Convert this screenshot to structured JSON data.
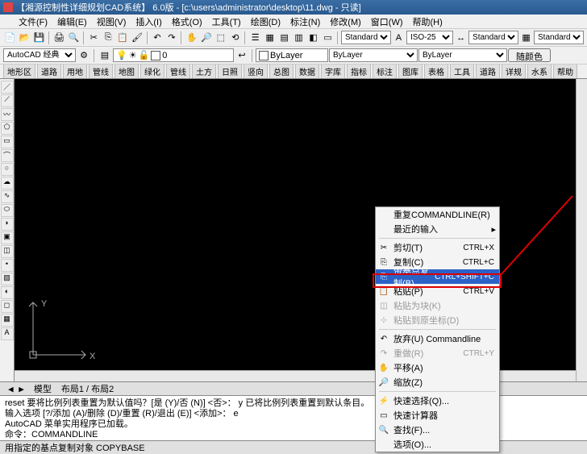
{
  "title": "【湘源控制性详细规划CAD系统】 6.0版 - [c:\\users\\administrator\\desktop\\11.dwg - 只读]",
  "menu": [
    "文件(F)",
    "编辑(E)",
    "视图(V)",
    "插入(I)",
    "格式(O)",
    "工具(T)",
    "绘图(D)",
    "标注(N)",
    "修改(M)",
    "窗口(W)",
    "帮助(H)"
  ],
  "workspace": "AutoCAD 经典",
  "layer_name": "0",
  "layer_bylayer": "ByLayer",
  "style": "Standard",
  "dim": "ISO-25",
  "table": "Standard",
  "table2": "Standard",
  "color_btn": "随颜色",
  "tabs": [
    "地形区",
    "道路",
    "用地",
    "管线",
    "地图",
    "绿化",
    "管线",
    "土方",
    "日照",
    "竖向",
    "总图",
    "数据",
    "字库",
    "指标",
    "标注",
    "图库",
    "表格",
    "工具",
    "道路",
    "详规",
    "水系",
    "帮助"
  ],
  "bottom": {
    "tab1": "模型",
    "tab2": "布局1 / 布局2"
  },
  "cmd": {
    "line1": "reset 要将比例列表重置为默认值吗？[是 (Y)/否 (N)] <否>：  y 已将比例列表重置到默认条目。",
    "line2": "输入选项 [?/添加 (A)/删除 (D)/重置 (R)/退出 (E)] <添加>：  e",
    "line3": "AutoCAD 菜单实用程序已加载。",
    "line4": "命令：COMMANDLINE"
  },
  "status": "用指定的基点复制对象  COPYBASE",
  "context": {
    "reset": "重复COMMANDLINE(R)",
    "recent": "最近的输入",
    "cut": "剪切(T)",
    "copy": "复制(C)",
    "copybase": "带基点复制(B)",
    "paste": "粘贴(P)",
    "pasteblock": "粘贴为块(K)",
    "pastecoord": "粘贴到原坐标(D)",
    "abort": "放弃(U) Commandline",
    "redo": "重做(R)",
    "pan": "平移(A)",
    "zoom": "缩放(Z)",
    "quick": "快速选择(Q)...",
    "calc": "快速计算器",
    "find": "查找(F)...",
    "options": "选项(O)...",
    "sc_cut": "CTRL+X",
    "sc_copy": "CTRL+C",
    "sc_copybase": "CTRL+SHIFT+C",
    "sc_paste": "CTRL+V",
    "sc_redo": "CTRL+Y"
  }
}
